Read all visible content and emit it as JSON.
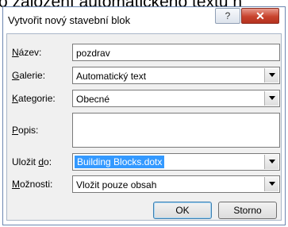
{
  "background_text": "o založení automatického textu n",
  "dialog": {
    "title": "Vytvořit nový stavební blok",
    "help_glyph": "?",
    "close_glyph": "✕"
  },
  "fields": {
    "name": {
      "label_key": "N",
      "label_rest": "ázev:",
      "value": "pozdrav"
    },
    "gallery": {
      "label_key": "G",
      "label_rest": "alerie:",
      "value": "Automatický text"
    },
    "category": {
      "label_key": "K",
      "label_rest": "ategorie:",
      "value": "Obecné"
    },
    "description": {
      "label_key": "P",
      "label_rest": "opis:",
      "value": ""
    },
    "save_to": {
      "label_pre": "Uložit ",
      "label_key": "d",
      "label_rest": "o:",
      "value": "Building Blocks.dotx"
    },
    "options": {
      "label_key": "M",
      "label_rest": "ožnosti:",
      "value": "Vložit pouze obsah"
    }
  },
  "buttons": {
    "ok": "OK",
    "cancel": "Storno"
  },
  "colors": {
    "selection": "#3399ff",
    "close": "#c8432d"
  }
}
